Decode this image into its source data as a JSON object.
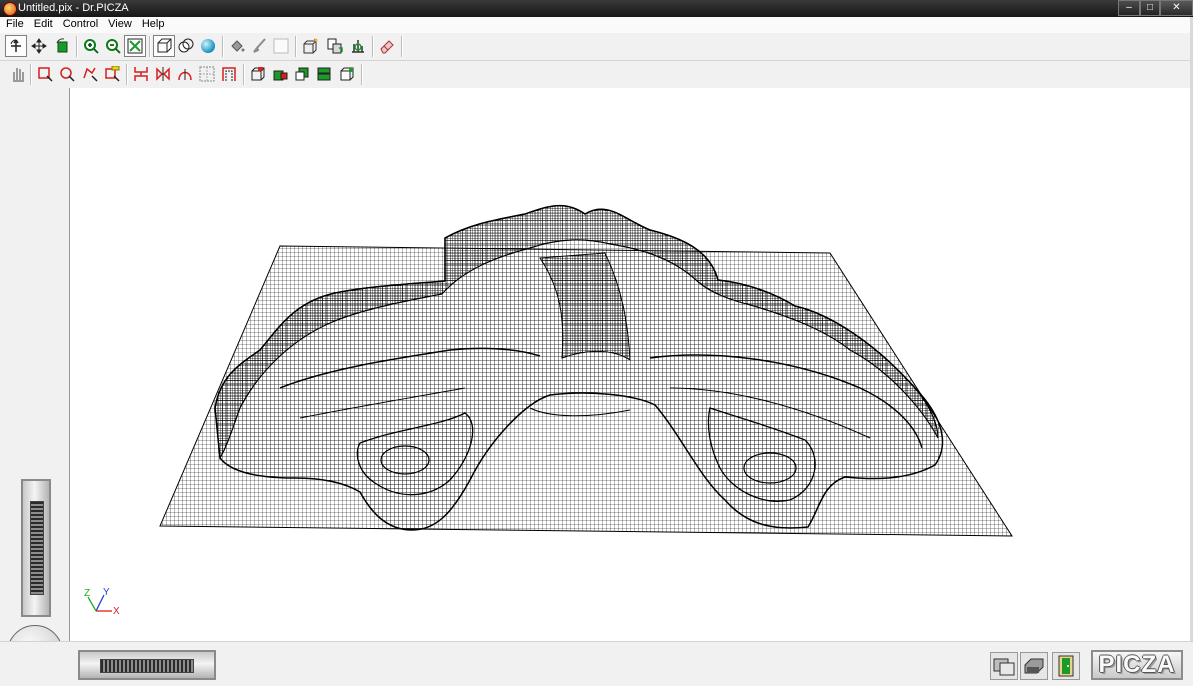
{
  "window": {
    "title": "Untitled.pix - Dr.PICZA",
    "minimize_label": "‒",
    "maximize_label": "□",
    "close_label": "✕"
  },
  "menu": [
    "File",
    "Edit",
    "Control",
    "View",
    "Help"
  ],
  "axes": {
    "z": "Z",
    "y": "Y",
    "x": "X"
  },
  "logo": "PICZA",
  "colors": {
    "title_bar": "#222222",
    "toolbar_bg": "#f1f1f1",
    "icon_red": "#d61f1f",
    "icon_green": "#1b9a2a",
    "sphere_cyan": "#19b6e0",
    "axis_x": "#e02020",
    "axis_y": "#2040e0",
    "axis_z": "#20b020"
  },
  "toolbar_row1": [
    {
      "name": "rotate-tool-icon",
      "pressed": true
    },
    {
      "name": "move-tool-icon",
      "pressed": false
    },
    {
      "name": "green-rotate-icon",
      "pressed": false
    },
    {
      "name": "zoom-in-icon",
      "pressed": false
    },
    {
      "name": "zoom-out-icon",
      "pressed": false
    },
    {
      "name": "zoom-fit-icon",
      "pressed": false
    },
    {
      "name": "wireframe-view-icon",
      "pressed": true
    },
    {
      "name": "hidden-line-view-icon",
      "pressed": false
    },
    {
      "name": "shaded-sphere-view-icon",
      "pressed": false
    },
    {
      "name": "paint-bucket-icon",
      "pressed": false
    },
    {
      "name": "brush-icon",
      "pressed": false
    },
    {
      "name": "blank-icon",
      "pressed": false
    },
    {
      "name": "import-model-icon",
      "pressed": false
    },
    {
      "name": "copy-model-icon",
      "pressed": false
    },
    {
      "name": "relief-settings-icon",
      "pressed": false
    },
    {
      "name": "eraser-icon",
      "pressed": false
    }
  ],
  "toolbar_row2": [
    {
      "name": "hand-pan-icon",
      "pressed": false
    },
    {
      "name": "rect-select-icon",
      "pressed": false
    },
    {
      "name": "lasso-select-icon",
      "pressed": false
    },
    {
      "name": "polygon-select-icon",
      "pressed": false
    },
    {
      "name": "magic-select-icon",
      "pressed": false
    },
    {
      "name": "compress-icon",
      "pressed": false
    },
    {
      "name": "mirror-icon",
      "pressed": false
    },
    {
      "name": "arch-icon",
      "pressed": false
    },
    {
      "name": "grid-select-icon",
      "pressed": false
    },
    {
      "name": "frame-select-icon",
      "pressed": false
    },
    {
      "name": "box-red-icon",
      "pressed": false
    },
    {
      "name": "box-green-red-icon",
      "pressed": false
    },
    {
      "name": "box-green-icon",
      "pressed": false
    },
    {
      "name": "box-stack-icon",
      "pressed": false
    },
    {
      "name": "box-outline-icon",
      "pressed": false
    }
  ],
  "status_buttons": [
    "windows-icon",
    "printer-icon",
    "exit-door-icon"
  ]
}
